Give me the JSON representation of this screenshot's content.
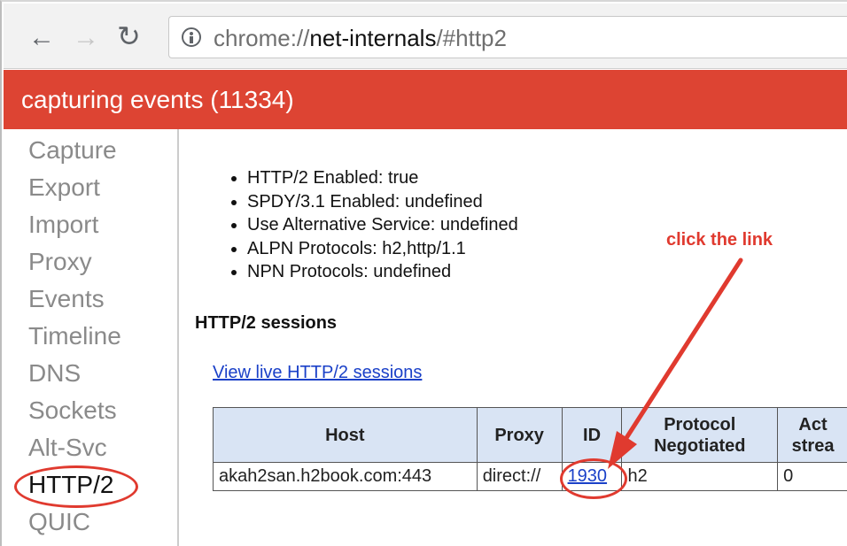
{
  "toolbar": {
    "back_icon": "arrow-left-icon",
    "forward_icon": "arrow-right-icon",
    "reload_icon": "reload-icon",
    "info_icon": "info-icon",
    "url_scheme": "chrome://",
    "url_host": "net-internals",
    "url_path": "/#http2"
  },
  "capture_bar": {
    "text": "capturing events (11334)",
    "color": "#dd4433"
  },
  "sidebar": {
    "items": [
      {
        "label": "Capture"
      },
      {
        "label": "Export"
      },
      {
        "label": "Import"
      },
      {
        "label": "Proxy"
      },
      {
        "label": "Events"
      },
      {
        "label": "Timeline"
      },
      {
        "label": "DNS"
      },
      {
        "label": "Sockets"
      },
      {
        "label": "Alt-Svc"
      },
      {
        "label": "HTTP/2"
      },
      {
        "label": "QUIC"
      }
    ],
    "active": "HTTP/2"
  },
  "main": {
    "status": [
      "HTTP/2 Enabled: true",
      "SPDY/3.1 Enabled: undefined",
      "Use Alternative Service: undefined",
      "ALPN Protocols: h2,http/1.1",
      "NPN Protocols: undefined"
    ],
    "sessions_title": "HTTP/2 sessions",
    "live_link": "View live HTTP/2 sessions",
    "table": {
      "headers": {
        "host": "Host",
        "proxy": "Proxy",
        "id": "ID",
        "protocol_line1": "Protocol",
        "protocol_line2": "Negotiated",
        "active_line1": "Act",
        "active_line2": "strea"
      },
      "rows": [
        {
          "host": "akah2san.h2book.com:443",
          "proxy": "direct://",
          "id": "1930",
          "protocol": "h2",
          "active": "0"
        }
      ]
    }
  },
  "annotation": {
    "text": "click the link",
    "color": "#e03a2f"
  }
}
